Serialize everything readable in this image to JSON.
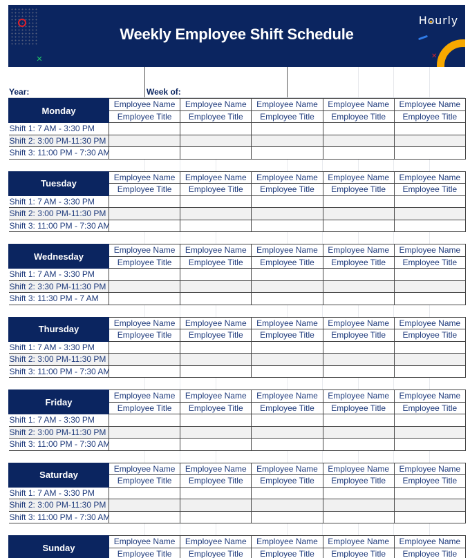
{
  "header": {
    "title": "Weekly Employee Shift Schedule",
    "logo": "Hourly",
    "colors": {
      "navy": "#0b2560",
      "accent_orange": "#f7a800",
      "accent_red": "#e0202a",
      "accent_green": "#1fc76a",
      "accent_blue": "#2f7be8"
    }
  },
  "meta": {
    "year_label": "Year:",
    "week_label": "Week of:"
  },
  "columns": {
    "name_label": "Employee Name",
    "title_label": "Employee Title",
    "count": 5
  },
  "days": [
    {
      "name": "Monday",
      "shifts": [
        "Shift 1: 7 AM - 3:30 PM",
        "Shift 2: 3:00 PM-11:30 PM",
        "Shift 3: 11:00 PM - 7:30 AM"
      ]
    },
    {
      "name": "Tuesday",
      "shifts": [
        "Shift 1: 7 AM - 3:30 PM",
        "Shift 2: 3:00 PM-11:30 PM",
        "Shift 3: 11:00 PM - 7:30 AM"
      ]
    },
    {
      "name": "Wednesday",
      "shifts": [
        "Shift 1: 7 AM - 3:30 PM",
        "Shift 2: 3:30 PM-11:30 PM",
        "Shift 3: 11:30 PM - 7 AM"
      ]
    },
    {
      "name": "Thursday",
      "shifts": [
        "Shift 1: 7 AM - 3:30 PM",
        "Shift 2: 3:00 PM-11:30 PM",
        "Shift 3: 11:00 PM - 7:30 AM"
      ]
    },
    {
      "name": "Friday",
      "shifts": [
        "Shift 1: 7 AM - 3:30 PM",
        "Shift 2: 3:00 PM-11:30 PM",
        "Shift 3: 11:00 PM - 7:30 AM"
      ]
    },
    {
      "name": "Saturday",
      "shifts": [
        "Shift 1: 7 AM - 3:30 PM",
        "Shift 2: 3:00 PM-11:30 PM",
        "Shift 3: 11:00 PM - 7:30 AM"
      ]
    },
    {
      "name": "Sunday",
      "shifts": []
    }
  ]
}
